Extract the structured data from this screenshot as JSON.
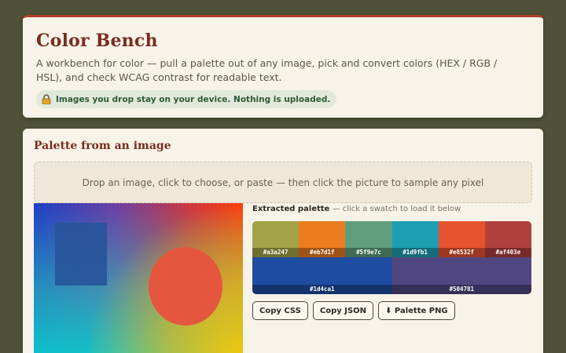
{
  "header": {
    "title": "Color Bench",
    "description": "A workbench for color — pull a palette out of any image, pick and convert colors (HEX / RGB / HSL), and check WCAG contrast for readable text.",
    "privacy_note": "Images you drop stay on your device. Nothing is uploaded.",
    "privacy_icon": "lock-icon"
  },
  "palette_section": {
    "title": "Palette from an image",
    "dropzone_text": "Drop an image, click to choose, or paste — then click the picture to sample any pixel",
    "extracted_label": "Extracted palette",
    "extracted_hint": " — click a swatch to load it below",
    "swatches": [
      {
        "hex": "#a3a247"
      },
      {
        "hex": "#eb7d1f"
      },
      {
        "hex": "#5f9e7c"
      },
      {
        "hex": "#1d9fb1"
      },
      {
        "hex": "#e8532f"
      },
      {
        "hex": "#af403e"
      },
      {
        "hex": "#1d4ca1"
      },
      {
        "hex": "#504781"
      }
    ],
    "buttons": {
      "copy_css": "Copy CSS",
      "copy_json": "Copy JSON",
      "palette_png": "⬇ Palette PNG"
    }
  },
  "colors": {
    "background": "#4f5237",
    "card": "#f7f3e8",
    "accent": "#b0402b",
    "title": "#7a2c20",
    "privacy_badge_bg": "#e2e9dc",
    "privacy_badge_text": "#2e5a34"
  }
}
